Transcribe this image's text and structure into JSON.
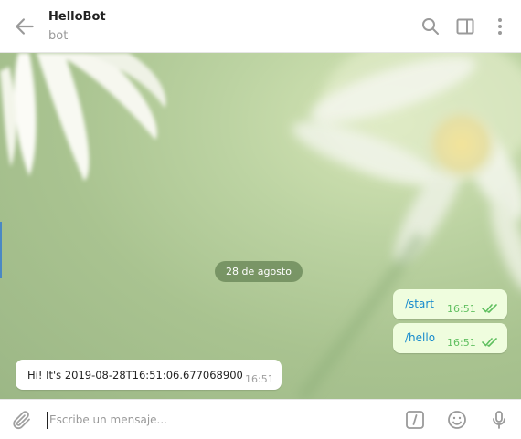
{
  "header": {
    "title": "HelloBot",
    "subtitle": "bot"
  },
  "chat": {
    "date_label": "28 de agosto",
    "outgoing": [
      {
        "text": "/start",
        "time": "16:51",
        "status": "read"
      },
      {
        "text": "/hello",
        "time": "16:51",
        "status": "read"
      }
    ],
    "incoming": [
      {
        "text": "Hi! It's 2019-08-28T16:51:06.677068900",
        "time": "16:51"
      }
    ]
  },
  "composer": {
    "placeholder": "Escribe un mensaje..."
  },
  "icons": {
    "back": "arrow-left-icon",
    "search": "search-icon",
    "panel": "side-panel-icon",
    "menu": "more-vertical-icon",
    "attach": "paperclip-icon",
    "commands": "slash-command-icon",
    "emoji": "smile-icon",
    "voice": "microphone-icon"
  },
  "colors": {
    "outgoing_bubble": "#effdde",
    "link_text": "#168acd",
    "read_check": "#5fbf5f",
    "date_pill": "#658354"
  }
}
